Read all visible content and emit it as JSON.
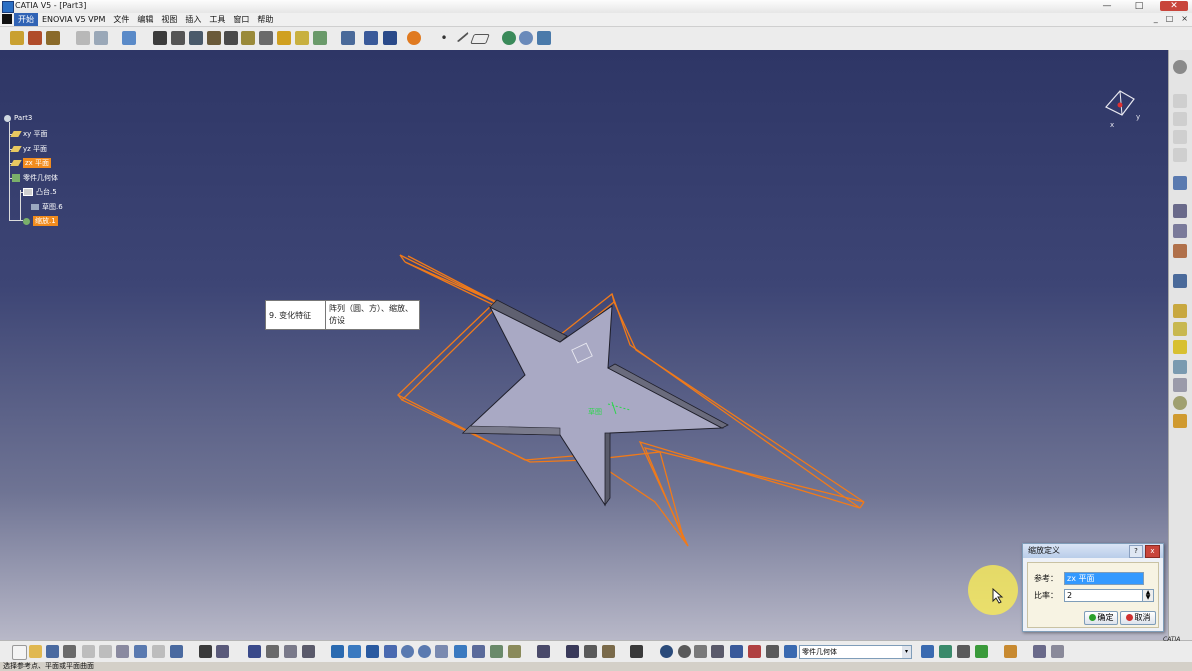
{
  "window": {
    "title": "CATIA V5 - [Part3]",
    "buttons": {
      "minimize": "—",
      "maximize": "□",
      "close": "✕"
    }
  },
  "menu": {
    "items": [
      "开始",
      "ENOVIA V5 VPM",
      "文件",
      "编辑",
      "视图",
      "插入",
      "工具",
      "窗口",
      "帮助"
    ],
    "active": "开始",
    "mdi_buttons": [
      "_",
      "□",
      "×"
    ]
  },
  "tree": {
    "root": "Part3",
    "nodes": [
      {
        "label": "xy 平面",
        "highlight": false
      },
      {
        "label": "yz 平面",
        "highlight": false
      },
      {
        "label": "zx 平面",
        "highlight": true
      },
      {
        "label": "零件几何体",
        "highlight": false
      },
      {
        "label": "凸台.5",
        "highlight": false
      },
      {
        "label": "草图.6",
        "highlight": false
      },
      {
        "label": "缩放.1",
        "highlight": true
      }
    ]
  },
  "tooltip_table": {
    "left": "9. 变化特征",
    "right": "阵列（圆、方）、缩放、仿设"
  },
  "dialog": {
    "title": "缩放定义",
    "help_label": "?",
    "close_label": "x",
    "reference_label": "参考：",
    "reference_value": "zx 平面",
    "ratio_label": "比率：",
    "ratio_value": "2",
    "spin_up": "▲",
    "spin_down": "▼",
    "ok_label": "确定",
    "cancel_label": "取消"
  },
  "viewport": {
    "sketch_label": "草图",
    "compass_axes": {
      "x": "x",
      "y": "y"
    }
  },
  "bottom_toolbar": {
    "combo_value": "零件几何体",
    "combo_arrow": "▾"
  },
  "status": {
    "text": "选择参考点、平面或平面曲面"
  },
  "logo": "CATIA",
  "colors": {
    "accent": "#3063b5",
    "highlight": "#f28c1e",
    "wireframe": "#f07a1a",
    "part_face": "#a9a9c4"
  }
}
